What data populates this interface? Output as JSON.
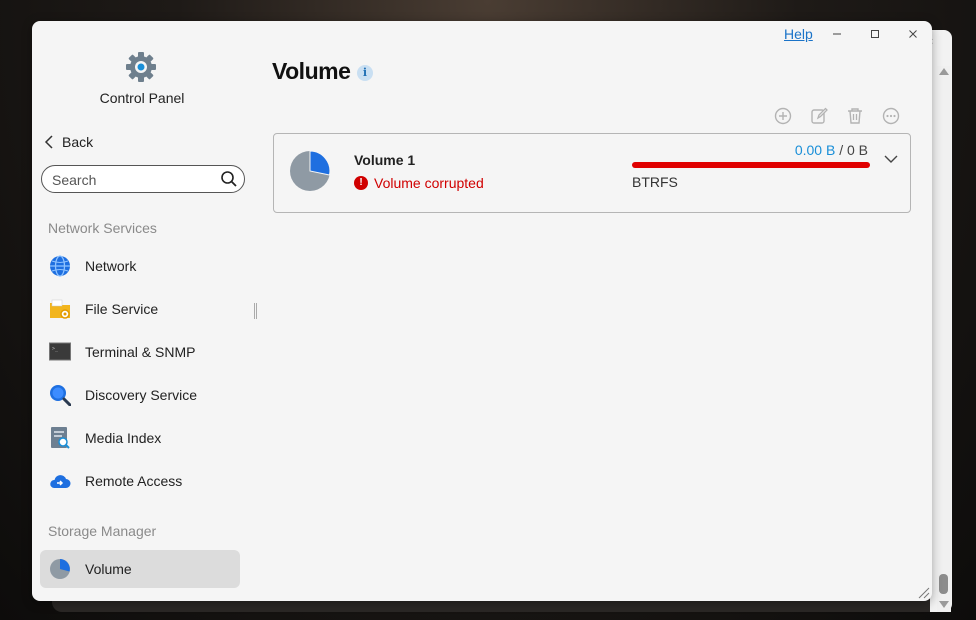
{
  "app": {
    "title": "Control Panel",
    "back_label": "Back",
    "help_label": "Help"
  },
  "search": {
    "placeholder": "Search"
  },
  "sidebar": {
    "sections": [
      {
        "title": "Network Services",
        "items": [
          {
            "label": "Network",
            "icon": "globe-icon"
          },
          {
            "label": "File Service",
            "icon": "folder-gear-icon"
          },
          {
            "label": "Terminal & SNMP",
            "icon": "terminal-icon"
          },
          {
            "label": "Discovery Service",
            "icon": "magnifier-icon"
          },
          {
            "label": "Media Index",
            "icon": "media-index-icon"
          },
          {
            "label": "Remote Access",
            "icon": "cloud-icon"
          }
        ]
      },
      {
        "title": "Storage Manager",
        "items": [
          {
            "label": "Volume",
            "icon": "pie-icon",
            "active": true
          }
        ]
      }
    ]
  },
  "main": {
    "title": "Volume",
    "info_glyph": "i",
    "toolbar": [
      "add-icon",
      "edit-icon",
      "trash-icon",
      "more-icon"
    ],
    "volumes": [
      {
        "name": "Volume 1",
        "status": "Volume corrupted",
        "status_glyph": "!",
        "used": "0.00 B",
        "separator": " / ",
        "total": "0 B",
        "filesystem": "BTRFS",
        "usage_fraction": 1.0
      }
    ]
  },
  "colors": {
    "accent": "#1a8fd8",
    "error": "#d00000",
    "bar": "#e00000",
    "link": "#1a73c8"
  }
}
